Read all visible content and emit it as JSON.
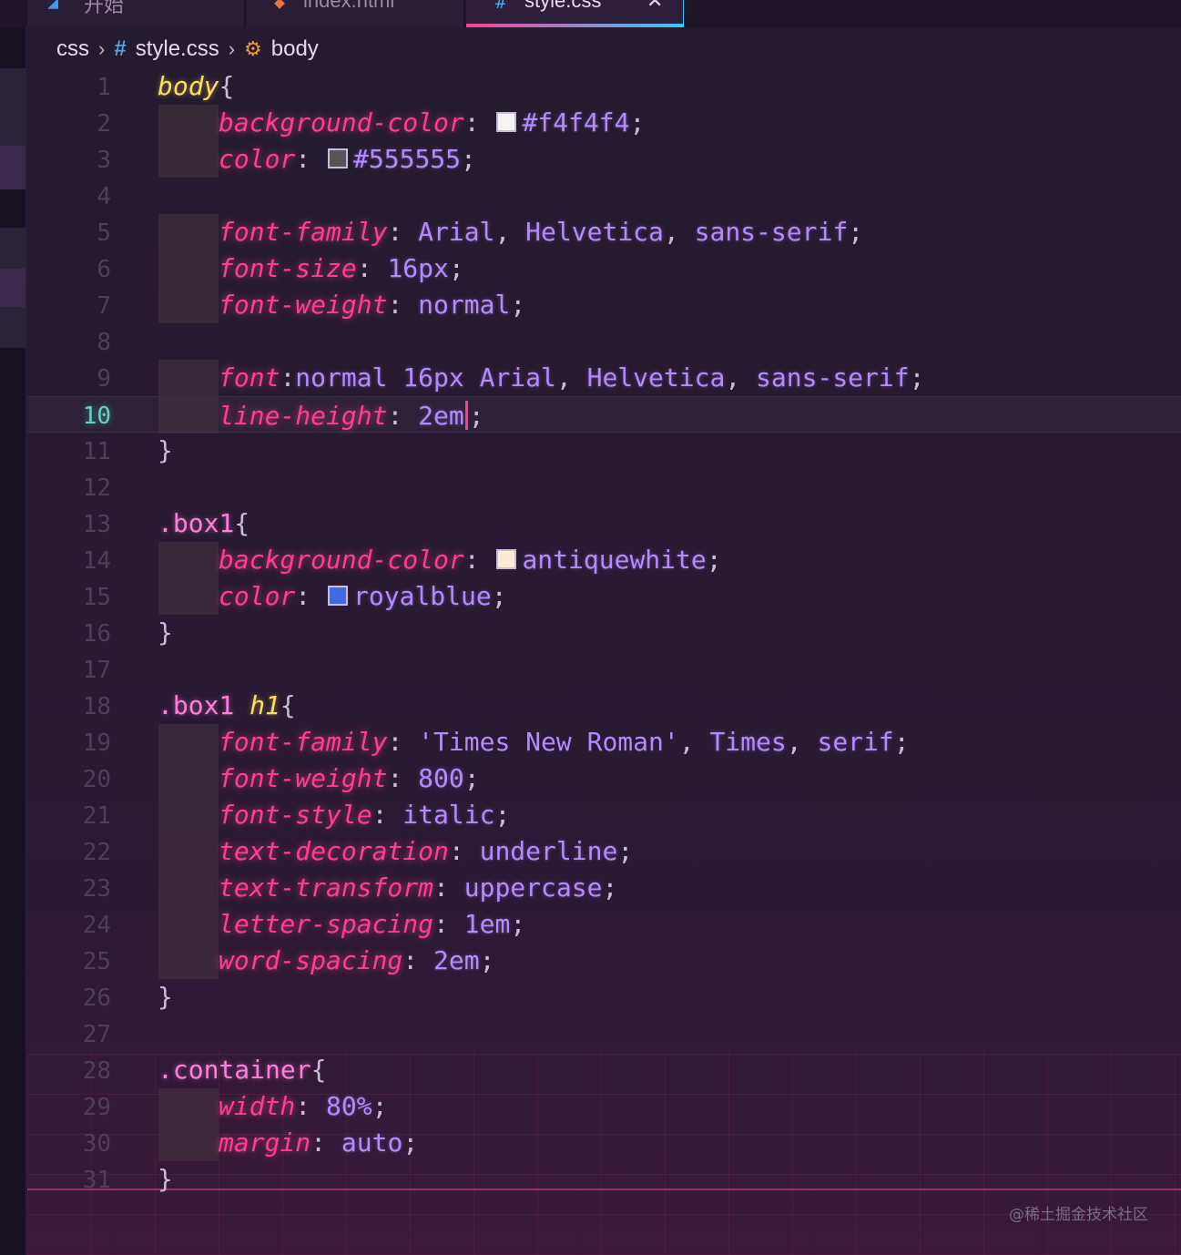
{
  "tabs": [
    {
      "label": "开始",
      "icon": "vscode-logo-icon",
      "active": false
    },
    {
      "label": "index.html",
      "icon": "html-file-icon",
      "active": false
    },
    {
      "label": "style.css",
      "icon": "css-hash-icon",
      "active": true,
      "close": "✕"
    }
  ],
  "breadcrumb": {
    "folder": "css",
    "sep": "›",
    "file_icon": "#",
    "file": "style.css",
    "symbol": "body"
  },
  "current_line": 10,
  "lines": [
    {
      "n": "1",
      "indent": false,
      "tokens": [
        [
          "sel",
          "body"
        ],
        [
          "punc",
          "{"
        ]
      ]
    },
    {
      "n": "2",
      "indent": true,
      "tokens": [
        [
          "prop",
          "background-color"
        ],
        [
          "punc",
          ": "
        ],
        [
          "swatch",
          "#f4f4f4"
        ],
        [
          "val",
          "#f4f4f4"
        ],
        [
          "punc",
          ";"
        ]
      ]
    },
    {
      "n": "3",
      "indent": true,
      "tokens": [
        [
          "prop",
          "color"
        ],
        [
          "punc",
          ": "
        ],
        [
          "swatch",
          "#555555"
        ],
        [
          "val",
          "#555555"
        ],
        [
          "punc",
          ";"
        ]
      ]
    },
    {
      "n": "4",
      "indent": false,
      "tokens": []
    },
    {
      "n": "5",
      "indent": true,
      "tokens": [
        [
          "prop",
          "font-family"
        ],
        [
          "punc",
          ": "
        ],
        [
          "val",
          "Arial"
        ],
        [
          "punc",
          ", "
        ],
        [
          "val",
          "Helvetica"
        ],
        [
          "punc",
          ", "
        ],
        [
          "val",
          "sans-serif"
        ],
        [
          "punc",
          ";"
        ]
      ]
    },
    {
      "n": "6",
      "indent": true,
      "tokens": [
        [
          "prop",
          "font-size"
        ],
        [
          "punc",
          ": "
        ],
        [
          "val",
          "16px"
        ],
        [
          "punc",
          ";"
        ]
      ]
    },
    {
      "n": "7",
      "indent": true,
      "tokens": [
        [
          "prop",
          "font-weight"
        ],
        [
          "punc",
          ": "
        ],
        [
          "val",
          "normal"
        ],
        [
          "punc",
          ";"
        ]
      ]
    },
    {
      "n": "8",
      "indent": false,
      "tokens": []
    },
    {
      "n": "9",
      "indent": true,
      "tokens": [
        [
          "prop",
          "font"
        ],
        [
          "punc",
          ":"
        ],
        [
          "val",
          "normal 16px Arial"
        ],
        [
          "punc",
          ", "
        ],
        [
          "val",
          "Helvetica"
        ],
        [
          "punc",
          ", "
        ],
        [
          "val",
          "sans-serif"
        ],
        [
          "punc",
          ";"
        ]
      ]
    },
    {
      "n": "10",
      "indent": true,
      "tokens": [
        [
          "prop",
          "line-height"
        ],
        [
          "punc",
          ": "
        ],
        [
          "val",
          "2em"
        ],
        [
          "cursor",
          ""
        ],
        [
          "punc",
          ";"
        ]
      ]
    },
    {
      "n": "11",
      "indent": false,
      "tokens": [
        [
          "punc",
          "}"
        ]
      ]
    },
    {
      "n": "12",
      "indent": false,
      "tokens": []
    },
    {
      "n": "13",
      "indent": false,
      "tokens": [
        [
          "cls",
          ".box1"
        ],
        [
          "punc",
          "{"
        ]
      ]
    },
    {
      "n": "14",
      "indent": true,
      "tokens": [
        [
          "prop",
          "background-color"
        ],
        [
          "punc",
          ": "
        ],
        [
          "swatch",
          "#faebd7"
        ],
        [
          "val",
          "antiquewhite"
        ],
        [
          "punc",
          ";"
        ]
      ]
    },
    {
      "n": "15",
      "indent": true,
      "tokens": [
        [
          "prop",
          "color"
        ],
        [
          "punc",
          ": "
        ],
        [
          "swatch",
          "#4169e1"
        ],
        [
          "val",
          "royalblue"
        ],
        [
          "punc",
          ";"
        ]
      ]
    },
    {
      "n": "16",
      "indent": false,
      "tokens": [
        [
          "punc",
          "}"
        ]
      ]
    },
    {
      "n": "17",
      "indent": false,
      "tokens": []
    },
    {
      "n": "18",
      "indent": false,
      "tokens": [
        [
          "cls",
          ".box1 "
        ],
        [
          "sel",
          "h1"
        ],
        [
          "punc",
          "{"
        ]
      ]
    },
    {
      "n": "19",
      "indent": true,
      "tokens": [
        [
          "prop",
          "font-family"
        ],
        [
          "punc",
          ": "
        ],
        [
          "str",
          "'Times New Roman'"
        ],
        [
          "punc",
          ", "
        ],
        [
          "val",
          "Times"
        ],
        [
          "punc",
          ", "
        ],
        [
          "val",
          "serif"
        ],
        [
          "punc",
          ";"
        ]
      ]
    },
    {
      "n": "20",
      "indent": true,
      "tokens": [
        [
          "prop",
          "font-weight"
        ],
        [
          "punc",
          ": "
        ],
        [
          "val",
          "800"
        ],
        [
          "punc",
          ";"
        ]
      ]
    },
    {
      "n": "21",
      "indent": true,
      "tokens": [
        [
          "prop",
          "font-style"
        ],
        [
          "punc",
          ": "
        ],
        [
          "val",
          "italic"
        ],
        [
          "punc",
          ";"
        ]
      ]
    },
    {
      "n": "22",
      "indent": true,
      "tokens": [
        [
          "prop",
          "text-decoration"
        ],
        [
          "punc",
          ": "
        ],
        [
          "val",
          "underline"
        ],
        [
          "punc",
          ";"
        ]
      ]
    },
    {
      "n": "23",
      "indent": true,
      "tokens": [
        [
          "prop",
          "text-transform"
        ],
        [
          "punc",
          ": "
        ],
        [
          "val",
          "uppercase"
        ],
        [
          "punc",
          ";"
        ]
      ]
    },
    {
      "n": "24",
      "indent": true,
      "tokens": [
        [
          "prop",
          "letter-spacing"
        ],
        [
          "punc",
          ": "
        ],
        [
          "val",
          "1em"
        ],
        [
          "punc",
          ";"
        ]
      ]
    },
    {
      "n": "25",
      "indent": true,
      "tokens": [
        [
          "prop",
          "word-spacing"
        ],
        [
          "punc",
          ": "
        ],
        [
          "val",
          "2em"
        ],
        [
          "punc",
          ";"
        ]
      ]
    },
    {
      "n": "26",
      "indent": false,
      "tokens": [
        [
          "punc",
          "}"
        ]
      ]
    },
    {
      "n": "27",
      "indent": false,
      "tokens": []
    },
    {
      "n": "28",
      "indent": false,
      "tokens": [
        [
          "cls",
          ".container"
        ],
        [
          "punc",
          "{"
        ]
      ]
    },
    {
      "n": "29",
      "indent": true,
      "tokens": [
        [
          "prop",
          "width"
        ],
        [
          "punc",
          ": "
        ],
        [
          "val",
          "80%"
        ],
        [
          "punc",
          ";"
        ]
      ]
    },
    {
      "n": "30",
      "indent": true,
      "tokens": [
        [
          "prop",
          "margin"
        ],
        [
          "punc",
          ": "
        ],
        [
          "val",
          "auto"
        ],
        [
          "punc",
          ";"
        ]
      ]
    },
    {
      "n": "31",
      "indent": false,
      "tokens": [
        [
          "punc",
          "}"
        ]
      ]
    }
  ],
  "watermark": "@稀土掘金技术社区"
}
